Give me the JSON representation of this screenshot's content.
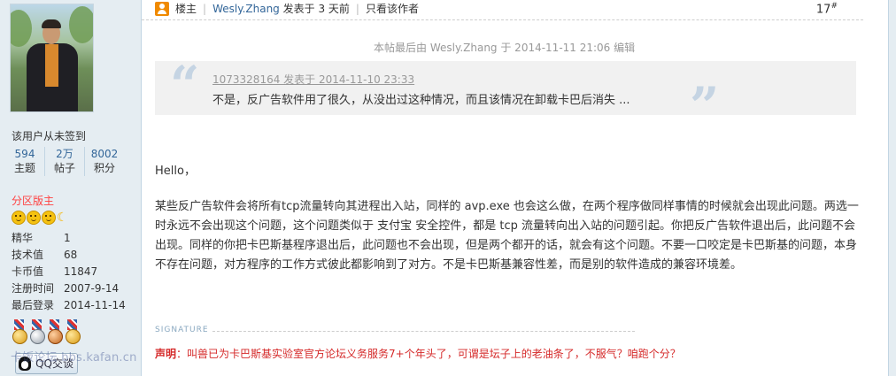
{
  "user": {
    "signin_text": "该用户从未签到",
    "stats": [
      {
        "value": "594",
        "label": "主题"
      },
      {
        "value": "2万",
        "label": "帖子"
      },
      {
        "value": "8002",
        "label": "积分"
      }
    ],
    "group": "分区版主",
    "info": [
      {
        "key": "精华",
        "value": "1"
      },
      {
        "key": "技术值",
        "value": "68"
      },
      {
        "key": "卡币值",
        "value": "11847"
      },
      {
        "key": "注册时间",
        "value": "2007-9-14"
      },
      {
        "key": "最后登录",
        "value": "2014-11-14"
      }
    ],
    "qq_button": "QQ交谈",
    "watermark": "卡饭论坛 bbs.kafan.cn"
  },
  "post": {
    "role": "楼主",
    "author": "Wesly.Zhang",
    "posted": "发表于 3 天前",
    "only_author": "只看该作者",
    "floor": "17",
    "floor_mark": "#",
    "edit_note": "本帖最后由 Wesly.Zhang 于 2014-11-11 21:06 编辑",
    "quote": {
      "meta": "1073328164 发表于 2014-11-10 23:33",
      "text": "不是，反广告软件用了很久，从没出过这种情况，而且该情况在卸载卡巴后消失 ..."
    },
    "greeting": "Hello，",
    "body": "某些反广告软件会将所有tcp流量转向其进程出入站，同样的 avp.exe 也会这么做，在两个程序做同样事情的时候就会出现此问题。两选一时永远不会出现这个问题，这个问题类似于 支付宝 安全控件，都是 tcp 流量转向出入站的问题引起。你把反广告软件退出后，此问题不会出现。同样的你把卡巴斯基程序退出后，此问题也不会出现，但是两个都开的话，就会有这个问题。不要一口咬定是卡巴斯基的问题，本身不存在问题，对方程序的工作方式彼此都影响到了对方。不是卡巴斯基兼容性差，而是别的软件造成的兼容环境差。",
    "signature_label": "SIGNATURE",
    "signature_prefix": "声明",
    "signature_text": "：叫兽已为卡巴斯基实验室官方论坛义务服务7+个年头了，可谓是坛子上的老油条了，不服气？咱跑个分？"
  },
  "colors": {
    "sidebar_bg": "#e5edf2",
    "link_blue": "#336699",
    "moderator_red": "#ff4040",
    "signature_red": "#d52929"
  }
}
